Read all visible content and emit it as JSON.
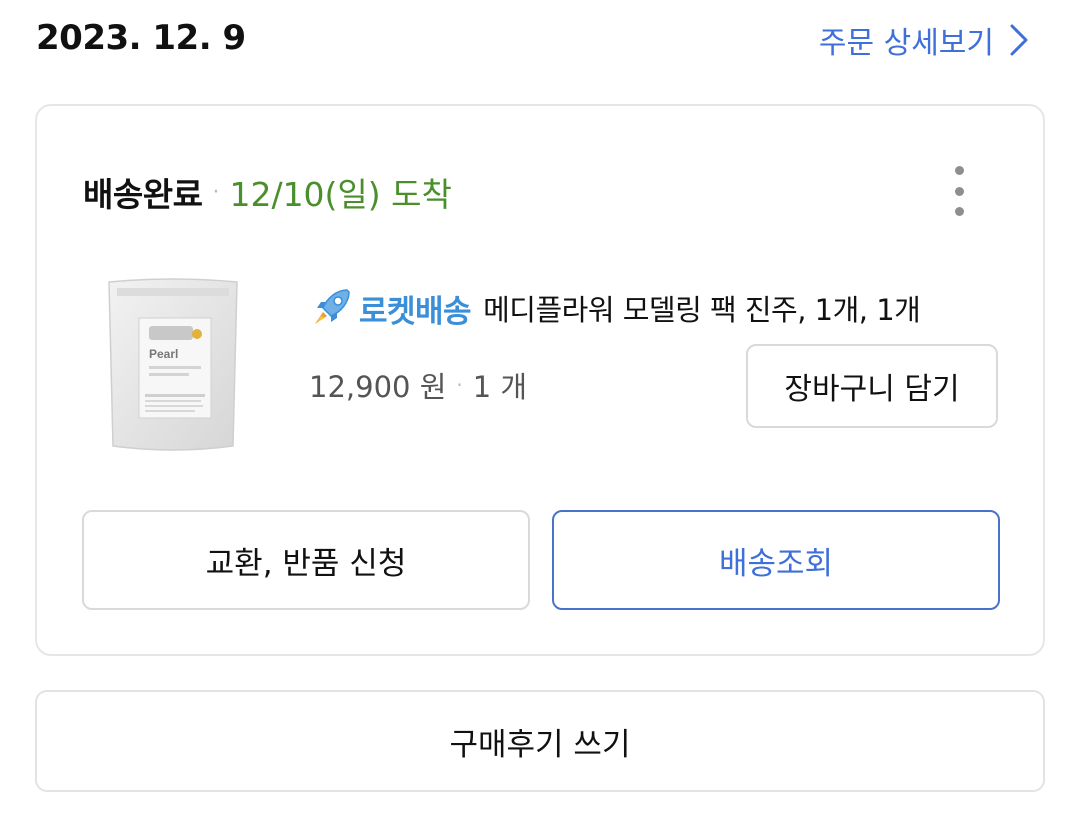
{
  "order": {
    "date": "2023. 12. 9",
    "detail_link_label": "주문 상세보기"
  },
  "delivery": {
    "status": "배송완료",
    "separator": "·",
    "arrival": "12/10(일) 도착"
  },
  "product": {
    "badge": "로켓배송",
    "name": "메디플라워 모델링 팩 진주, 1개, 1개",
    "price": "12,900 원",
    "separator": "·",
    "quantity": "1 개",
    "thumbnail_text": "Pearl"
  },
  "buttons": {
    "add_to_cart": "장바구니 담기",
    "exchange_return": "교환, 반품 신청",
    "track_delivery": "배송조회",
    "write_review": "구매후기 쓰기"
  },
  "colors": {
    "link_blue": "#3f6fd8",
    "arrival_green": "#4a8f2c",
    "rocket_blue": "#3a8fd8",
    "track_border": "#4a72c8"
  },
  "icons": {
    "detail_arrow": "chevron-right-icon",
    "more": "more-vertical-icon",
    "rocket": "rocket-icon"
  }
}
